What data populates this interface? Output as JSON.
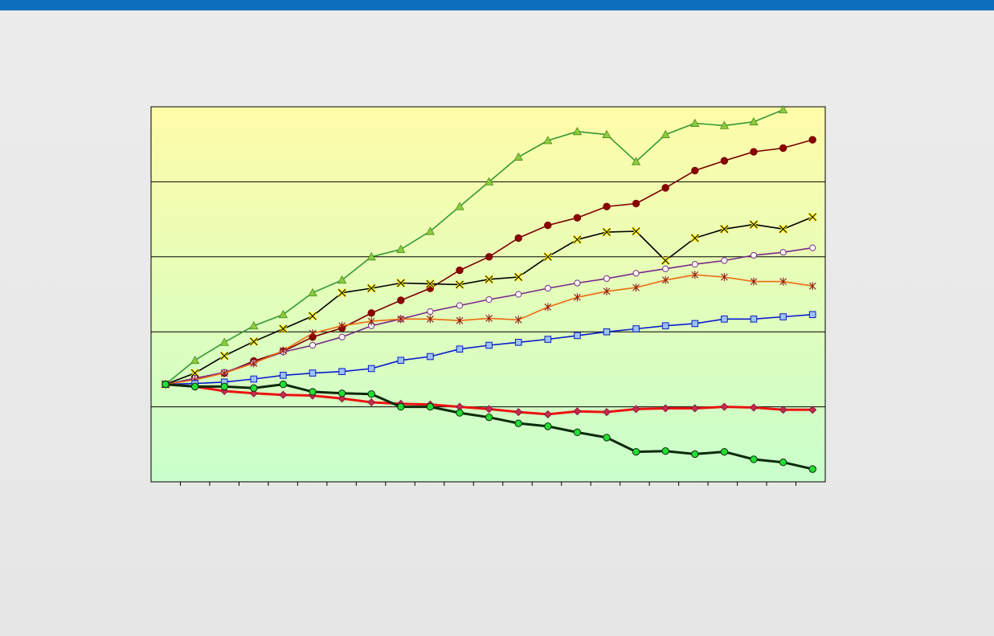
{
  "colors": {
    "top_bar": "#0a6ebd",
    "plot_top": "#fffca8",
    "plot_bottom": "#c8ffcc",
    "gridline": "#000000"
  },
  "chart_data": {
    "type": "line",
    "title": "",
    "xlabel": "",
    "ylabel": "",
    "grid": "horizontal",
    "legend": "none",
    "x": [
      1,
      2,
      3,
      4,
      5,
      6,
      7,
      8,
      9,
      10,
      11,
      12,
      13,
      14,
      15,
      16,
      17,
      18,
      19,
      20,
      21,
      22,
      23
    ],
    "ylim": [
      -1.0,
      4.0
    ],
    "yticks": [
      0,
      1,
      2,
      3,
      4
    ],
    "series": [
      {
        "color": "#339933",
        "marker": "triangle",
        "marker_fill": "#8ccc3c",
        "values": [
          0.3,
          0.62,
          0.86,
          1.08,
          1.23,
          1.52,
          1.69,
          2.0,
          2.1,
          2.34,
          2.67,
          3.0,
          3.33,
          3.55,
          3.67,
          3.63,
          3.27,
          3.63,
          3.78,
          3.75,
          3.8,
          3.96
        ]
      },
      {
        "color": "#7a0000",
        "marker": "circle",
        "marker_fill": "#8b0000",
        "values": [
          0.3,
          0.38,
          0.45,
          0.61,
          0.74,
          0.93,
          1.05,
          1.25,
          1.42,
          1.58,
          1.82,
          2.0,
          2.25,
          2.42,
          2.52,
          2.67,
          2.71,
          2.92,
          3.15,
          3.28,
          3.4,
          3.45,
          3.56
        ]
      },
      {
        "color": "#000000",
        "marker": "x",
        "marker_fill": "#ffee00",
        "values": [
          0.3,
          0.45,
          0.68,
          0.87,
          1.04,
          1.21,
          1.52,
          1.58,
          1.65,
          1.64,
          1.63,
          1.7,
          1.73,
          2.0,
          2.23,
          2.33,
          2.34,
          1.95,
          2.25,
          2.37,
          2.43,
          2.37,
          2.53
        ]
      },
      {
        "color": "#7a2a8a",
        "marker": "circle-open",
        "marker_fill": "#ffffff",
        "values": [
          0.3,
          0.38,
          0.46,
          0.59,
          0.73,
          0.82,
          0.93,
          1.08,
          1.17,
          1.27,
          1.35,
          1.43,
          1.5,
          1.58,
          1.65,
          1.71,
          1.78,
          1.84,
          1.9,
          1.95,
          2.02,
          2.06,
          2.12
        ]
      },
      {
        "color": "#ee6a10",
        "marker": "asterisk",
        "marker_fill": "#8b1a1a",
        "values": [
          0.3,
          0.36,
          0.45,
          0.58,
          0.75,
          0.98,
          1.08,
          1.14,
          1.17,
          1.17,
          1.15,
          1.18,
          1.16,
          1.33,
          1.46,
          1.54,
          1.59,
          1.69,
          1.76,
          1.73,
          1.67,
          1.67,
          1.61
        ]
      },
      {
        "color": "#0a1acc",
        "marker": "square",
        "marker_fill": "#9cc4ee",
        "values": [
          0.3,
          0.31,
          0.33,
          0.37,
          0.42,
          0.45,
          0.47,
          0.51,
          0.62,
          0.67,
          0.77,
          0.82,
          0.86,
          0.9,
          0.95,
          1.0,
          1.04,
          1.08,
          1.11,
          1.17,
          1.17,
          1.2,
          1.23
        ]
      },
      {
        "color": "#ee1111",
        "marker": "diamond",
        "marker_fill": "#c8284a",
        "values": [
          0.3,
          0.27,
          0.21,
          0.18,
          0.16,
          0.15,
          0.11,
          0.06,
          0.04,
          0.03,
          0.0,
          -0.03,
          -0.07,
          -0.1,
          -0.06,
          -0.07,
          -0.03,
          -0.02,
          -0.02,
          0.0,
          -0.01,
          -0.04,
          -0.04
        ]
      },
      {
        "color": "#0a2a0a",
        "marker": "circle",
        "marker_fill": "#22dd33",
        "values": [
          0.3,
          0.27,
          0.27,
          0.25,
          0.3,
          0.2,
          0.18,
          0.17,
          0.0,
          0.0,
          -0.08,
          -0.14,
          -0.22,
          -0.26,
          -0.34,
          -0.41,
          -0.6,
          -0.59,
          -0.63,
          -0.6,
          -0.7,
          -0.74,
          -0.83
        ]
      }
    ]
  }
}
